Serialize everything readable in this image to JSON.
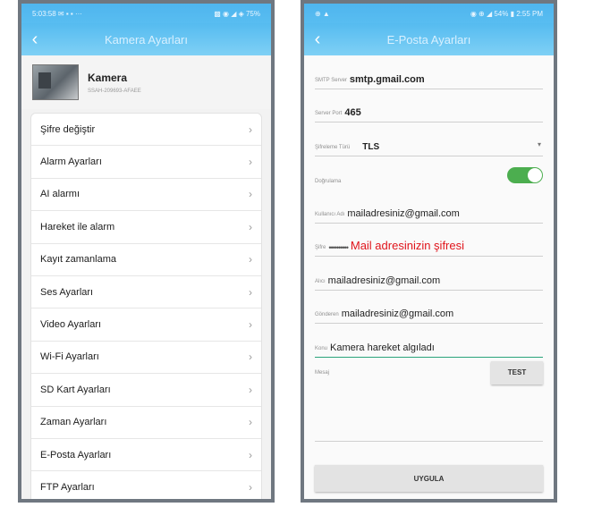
{
  "left": {
    "status": {
      "left": "5:03:58 ✉ ▪ ▪ ···",
      "right": "▩ ◉ ◢ ◈ 75%"
    },
    "title": "Kamera Ayarları",
    "camera": {
      "name": "Kamera",
      "id": "SSAH-209693-AFAEE"
    },
    "menu": [
      "Şifre değiştir",
      "Alarm Ayarları",
      "AI alarmı",
      "Hareket ile alarm",
      "Kayıt zamanlama",
      "Ses Ayarları",
      "Video Ayarları",
      "Wi-Fi Ayarları",
      "SD Kart Ayarları",
      "Zaman Ayarları",
      "E-Posta Ayarları",
      "FTP Ayarları"
    ]
  },
  "right": {
    "status": {
      "left": "⊕ ▲",
      "right": "◉ ⊕ ◢ 54% ▮ 2:55 PM"
    },
    "title": "E-Posta Ayarları",
    "smtp": {
      "label": "SMTP Server",
      "value": "smtp.gmail.com"
    },
    "port": {
      "label": "Server Port",
      "value": "465"
    },
    "encryption": {
      "label": "Şifreleme Türü",
      "value": "TLS"
    },
    "auth": {
      "label": "Doğrulama",
      "on": true
    },
    "user": {
      "label": "Kullanıcı Adı",
      "value": "mailadresiniz@gmail.com"
    },
    "password": {
      "label": "Şifre",
      "masked": "••••••••••",
      "note": "Mail adresinizin şifresi"
    },
    "to": {
      "label": "Alıcı",
      "value": "mailadresiniz@gmail.com"
    },
    "from": {
      "label": "Gönderen",
      "value": "mailadresiniz@gmail.com"
    },
    "subject": {
      "label": "Konu",
      "value": "Kamera hareket algıladı"
    },
    "message": {
      "label": "Mesaj"
    },
    "test_label": "TEST",
    "apply_label": "UYGULA"
  },
  "colors": {
    "accent": "#55bbf0",
    "toggle": "#4cae4f",
    "note": "#e0141b",
    "frame": "#6f7780"
  }
}
